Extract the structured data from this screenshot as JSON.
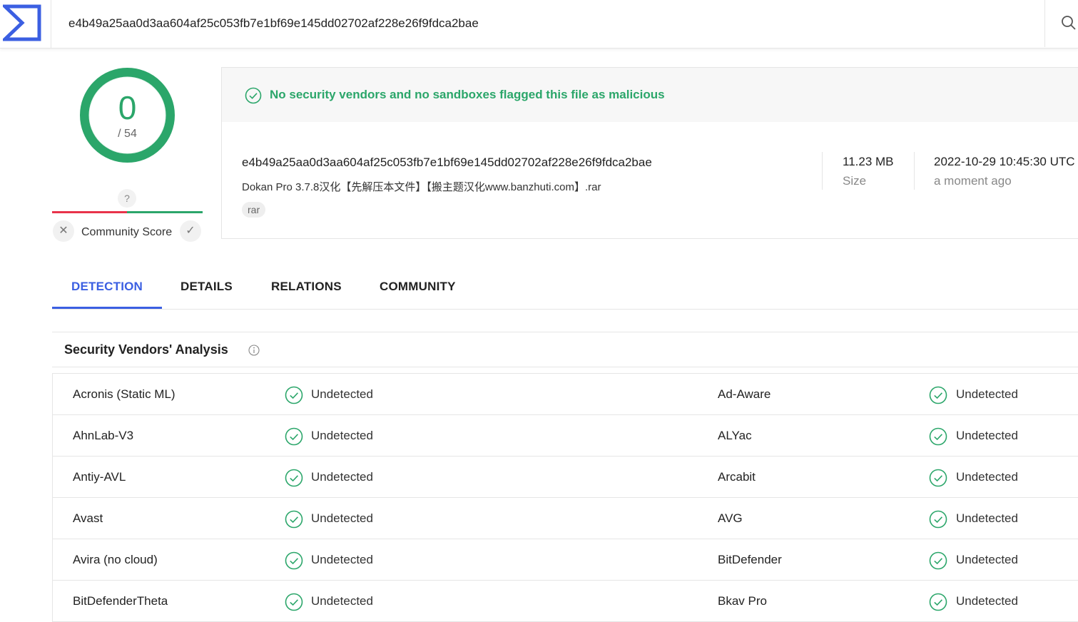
{
  "search": {
    "value": "e4b49a25aa0d3aa604af25c053fb7e1bf69e145dd02702af228e26f9fdca2bae"
  },
  "score": {
    "detections": "0",
    "total": "/ 54"
  },
  "community": {
    "unknown_label": "?",
    "label": "Community Score"
  },
  "banner": {
    "text": "No security vendors and no sandboxes flagged this file as malicious"
  },
  "file": {
    "hash": "e4b49a25aa0d3aa604af25c053fb7e1bf69e145dd02702af228e26f9fdca2bae",
    "name": "Dokan Pro 3.7.8汉化【先解压本文件】【搬主题汉化www.banzhuti.com】.rar",
    "tag": "rar",
    "size_value": "11.23 MB",
    "size_label": "Size",
    "date_value": "2022-10-29 10:45:30 UTC",
    "date_label": "a moment ago"
  },
  "tabs": [
    {
      "label": "DETECTION"
    },
    {
      "label": "DETAILS"
    },
    {
      "label": "RELATIONS"
    },
    {
      "label": "COMMUNITY"
    }
  ],
  "vendors": {
    "title": "Security Vendors' Analysis",
    "rows": [
      {
        "left_name": "Acronis (Static ML)",
        "left_result": "Undetected",
        "right_name": "Ad-Aware",
        "right_result": "Undetected"
      },
      {
        "left_name": "AhnLab-V3",
        "left_result": "Undetected",
        "right_name": "ALYac",
        "right_result": "Undetected"
      },
      {
        "left_name": "Antiy-AVL",
        "left_result": "Undetected",
        "right_name": "Arcabit",
        "right_result": "Undetected"
      },
      {
        "left_name": "Avast",
        "left_result": "Undetected",
        "right_name": "AVG",
        "right_result": "Undetected"
      },
      {
        "left_name": "Avira (no cloud)",
        "left_result": "Undetected",
        "right_name": "BitDefender",
        "right_result": "Undetected"
      },
      {
        "left_name": "BitDefenderTheta",
        "left_result": "Undetected",
        "right_name": "Bkav Pro",
        "right_result": "Undetected"
      }
    ]
  },
  "colors": {
    "accent": "#3b5fe2",
    "clean": "#2ba66a",
    "malicious": "#e8334a"
  }
}
